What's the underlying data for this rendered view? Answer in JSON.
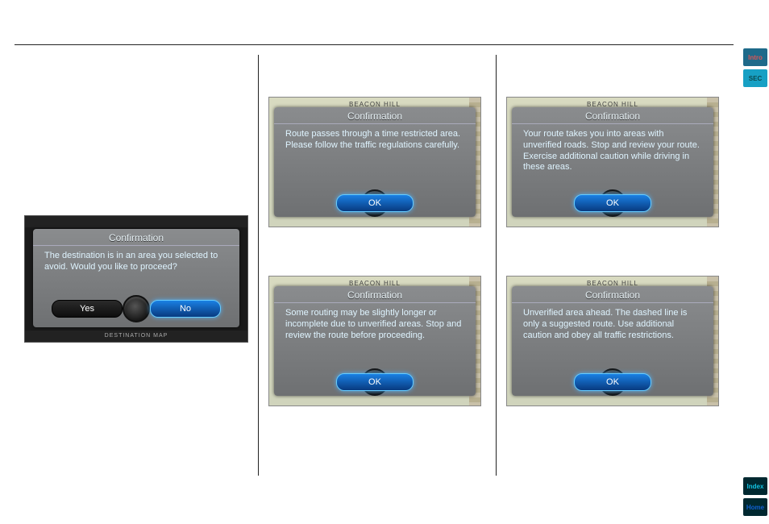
{
  "sideTabs": {
    "intro": "Intro",
    "sec": "SEC",
    "index": "Index",
    "home": "Home"
  },
  "mapLabel": "BEACON HILL",
  "col1": {
    "bottomBar": "DESTINATION MAP",
    "dialog": {
      "title": "Confirmation",
      "body": "The destination is in an area you selected to avoid.\nWould you like to proceed?",
      "yes": "Yes",
      "no": "No"
    }
  },
  "col2": {
    "shot1": {
      "title": "Confirmation",
      "body": "Route passes through a time restricted area. Please follow the traffic regulations carefully.",
      "ok": "OK"
    },
    "shot2": {
      "title": "Confirmation",
      "body": "Some routing may be slightly longer or incomplete due to unverified areas.\nStop and review the route before proceeding.",
      "ok": "OK"
    }
  },
  "col3": {
    "shot1": {
      "title": "Confirmation",
      "body": "Your route takes you into areas with unverified roads.\nStop and review your route.\nExercise additional caution while driving in these areas.",
      "ok": "OK"
    },
    "shot2": {
      "title": "Confirmation",
      "body": "Unverified area ahead.\nThe dashed line is\nonly a suggested route.\nUse additional caution and obey all traffic restrictions.",
      "ok": "OK"
    }
  }
}
